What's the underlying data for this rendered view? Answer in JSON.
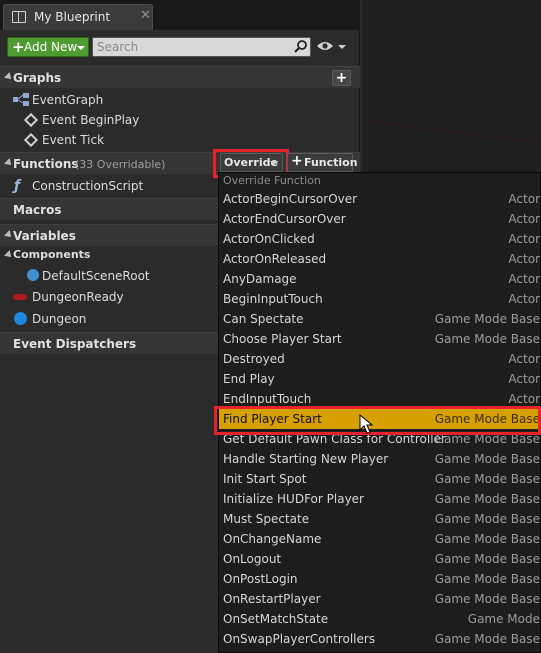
{
  "tab": {
    "title": "My Blueprint",
    "close": "✕"
  },
  "toolbar": {
    "add_new_label": "Add New",
    "search_placeholder": "Search"
  },
  "sections": {
    "graphs": {
      "title": "Graphs",
      "add": "+"
    },
    "functions": {
      "title": "Functions",
      "count": "(33 Overridable)"
    },
    "macros": {
      "title": "Macros"
    },
    "variables": {
      "title": "Variables"
    },
    "event_dispatchers": {
      "title": "Event Dispatchers"
    }
  },
  "graph_items": [
    "EventGraph",
    "Event BeginPlay",
    "Event Tick"
  ],
  "function_items": [
    "ConstructionScript"
  ],
  "variables": {
    "components_title": "Components",
    "items": [
      "DefaultSceneRoot",
      "DungeonReady",
      "Dungeon"
    ]
  },
  "buttons": {
    "override": "Override",
    "function": "Function"
  },
  "menu": {
    "header": "Override Function",
    "items": [
      {
        "name": "ActorBeginCursorOver",
        "category": "Actor"
      },
      {
        "name": "ActorEndCursorOver",
        "category": "Actor"
      },
      {
        "name": "ActorOnClicked",
        "category": "Actor"
      },
      {
        "name": "ActorOnReleased",
        "category": "Actor"
      },
      {
        "name": "AnyDamage",
        "category": "Actor"
      },
      {
        "name": "BeginInputTouch",
        "category": "Actor"
      },
      {
        "name": "Can Spectate",
        "category": "Game Mode Base"
      },
      {
        "name": "Choose Player Start",
        "category": "Game Mode Base"
      },
      {
        "name": "Destroyed",
        "category": "Actor"
      },
      {
        "name": "End Play",
        "category": "Actor"
      },
      {
        "name": "EndInputTouch",
        "category": "Actor"
      },
      {
        "name": "Find Player Start",
        "category": "Game Mode Base",
        "selected": true
      },
      {
        "name": "Get Default Pawn Class for Controller",
        "category": "Game Mode Base"
      },
      {
        "name": "Handle Starting New Player",
        "category": "Game Mode Base"
      },
      {
        "name": "Init Start Spot",
        "category": "Game Mode Base"
      },
      {
        "name": "Initialize HUDFor Player",
        "category": "Game Mode Base"
      },
      {
        "name": "Must Spectate",
        "category": "Game Mode Base"
      },
      {
        "name": "OnChangeName",
        "category": "Game Mode Base"
      },
      {
        "name": "OnLogout",
        "category": "Game Mode Base"
      },
      {
        "name": "OnPostLogin",
        "category": "Game Mode Base"
      },
      {
        "name": "OnRestartPlayer",
        "category": "Game Mode Base"
      },
      {
        "name": "OnSetMatchState",
        "category": "Game Mode"
      },
      {
        "name": "OnSwapPlayerControllers",
        "category": "Game Mode Base"
      }
    ]
  },
  "colors": {
    "add_new": "#4f9a31",
    "selected_row": "#d6a100",
    "highlight_box": "#e8222a"
  }
}
